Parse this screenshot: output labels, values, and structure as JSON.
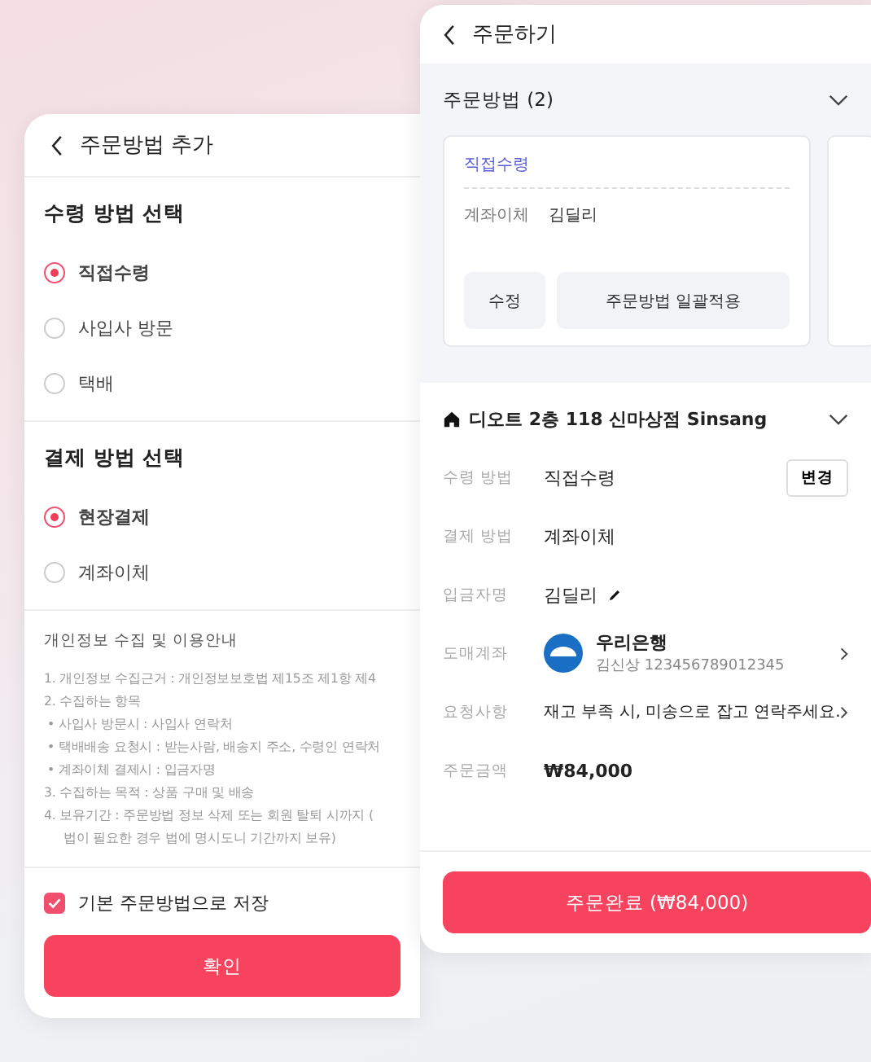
{
  "add_method_screen": {
    "title": "주문방법 추가",
    "receive_section": {
      "heading": "수령 방법 선택",
      "options": [
        {
          "label": "직접수령",
          "selected": true
        },
        {
          "label": "사입사 방문",
          "selected": false
        },
        {
          "label": "택배",
          "selected": false
        }
      ]
    },
    "payment_section": {
      "heading": "결제 방법 선택",
      "options": [
        {
          "label": "현장결제",
          "selected": true
        },
        {
          "label": "계좌이체",
          "selected": false
        }
      ]
    },
    "privacy": {
      "heading": "개인정보 수집 및 이용안내",
      "lines": [
        {
          "kind": "numbered",
          "text": "1. 개인정보 수집근거 : 개인정보보호법 제15조 제1항 제4"
        },
        {
          "kind": "numbered",
          "text": "2. 수집하는 항목"
        },
        {
          "kind": "bullet",
          "text": "• 사입사 방문시 : 사입사 연락처"
        },
        {
          "kind": "bullet",
          "text": "• 택배배송 요청시 : 받는사람, 배송지 주소, 수령인 연락처"
        },
        {
          "kind": "bullet",
          "text": "• 계좌이체 결제시 : 입금자명"
        },
        {
          "kind": "numbered",
          "text": "3. 수집하는 목적 : 상품 구매 및 배송"
        },
        {
          "kind": "numbered",
          "text": "4. 보유기간 : 주문방법 정보 삭제 또는 회원 탈퇴 시까지 ("
        },
        {
          "kind": "continued",
          "text": "법이 필요한 경우 법에 명시도니 기간까지 보유)"
        }
      ]
    },
    "save_default": {
      "label": "기본 주문방법으로 저장",
      "checked": true
    },
    "confirm_button": "확인"
  },
  "order_screen": {
    "title": "주문하기",
    "methods": {
      "heading": "주문방법 (2)",
      "cards": [
        {
          "receive": "직접수령",
          "payment": "계좌이체",
          "name": "김딜리",
          "buttons": [
            "수정",
            "주문방법 일괄적용"
          ]
        }
      ]
    },
    "store": {
      "name": "디오트 2층 118 신마상점 Sinsang",
      "rows": [
        {
          "kind": "action",
          "label": "수령 방법",
          "value": "직접수령",
          "action": "변경"
        },
        {
          "kind": "plain",
          "label": "결제 방법",
          "value": "계좌이체"
        },
        {
          "kind": "editable",
          "label": "입금자명",
          "value": "김딜리"
        },
        {
          "kind": "bank",
          "label": "도매계좌",
          "value": "우리은행",
          "account": "김신상 123456789012345"
        },
        {
          "kind": "link",
          "label": "요청사항",
          "value": "재고 부족 시, 미송으로 잡고 연락주세요."
        },
        {
          "kind": "price",
          "label": "주문금액",
          "value": "₩84,000"
        }
      ]
    },
    "submit_button": "주문완료 (₩84,000)"
  }
}
